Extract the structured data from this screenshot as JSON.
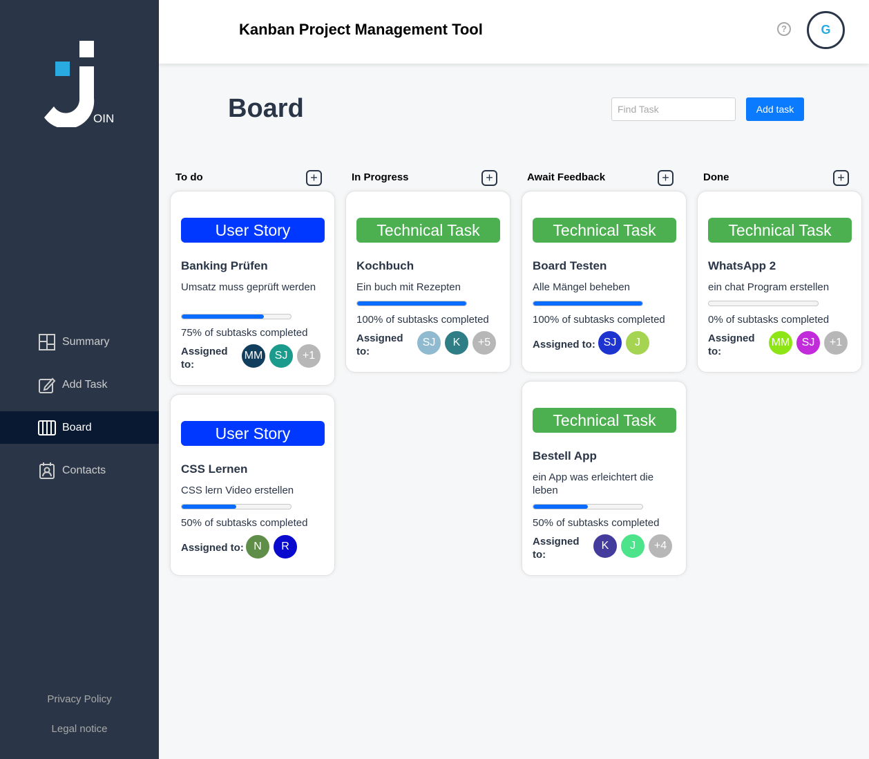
{
  "sidebar": {
    "nav": [
      {
        "label": "Summary",
        "icon": "summary-icon"
      },
      {
        "label": "Add Task",
        "icon": "add-task-icon"
      },
      {
        "label": "Board",
        "icon": "board-icon"
      },
      {
        "label": "Contacts",
        "icon": "contacts-icon"
      }
    ],
    "active": "Board",
    "privacy": "Privacy Policy",
    "legal": "Legal notice",
    "logo_text": "OIN"
  },
  "header": {
    "title": "Kanban Project Management Tool",
    "help": "?",
    "user_initial": "G"
  },
  "board": {
    "title": "Board",
    "search_placeholder": "Find Task",
    "add_task": "Add task"
  },
  "columns": [
    {
      "title": "To do",
      "plus": "+"
    },
    {
      "title": "In Progress",
      "plus": "+"
    },
    {
      "title": "Await Feedback",
      "plus": "+"
    },
    {
      "title": "Done",
      "plus": "+"
    }
  ],
  "cards": [
    {
      "category": "User Story",
      "title": "Banking Prüfen",
      "description": "Umsatz muss geprüft werden",
      "progress": 0.75,
      "progress_text": "75% of subtasks completed",
      "assigned_label": "Assigned to:",
      "avatars": [
        {
          "initials": "MM",
          "color": "#123E5E"
        },
        {
          "initials": "SJ",
          "color": "#1A9B8C"
        },
        {
          "initials": "+1",
          "color": "#B7B7B7"
        }
      ]
    },
    {
      "category": "User Story",
      "title": "CSS Lernen",
      "description": "CSS lern Video erstellen",
      "progress": 0.5,
      "progress_text": "50% of subtasks completed",
      "assigned_label": "Assigned to:",
      "avatars": [
        {
          "initials": "N",
          "color": "#5E8E48"
        },
        {
          "initials": "R",
          "color": "#0A0ACF"
        }
      ]
    },
    {
      "category": "Technical Task",
      "title": "Kochbuch",
      "description": "Ein buch mit Rezepten",
      "progress": 1.0,
      "progress_text": "100% of subtasks completed",
      "assigned_label": "Assigned to:",
      "avatars": [
        {
          "initials": "SJ",
          "color": "#8FBAD0"
        },
        {
          "initials": "K",
          "color": "#2F7E86"
        },
        {
          "initials": "+5",
          "color": "#B7B7B7"
        }
      ]
    },
    {
      "category": "Technical Task",
      "title": "Board Testen",
      "description": "Alle Mängel beheben",
      "progress": 1.0,
      "progress_text": "100% of subtasks completed",
      "assigned_label": "Assigned to:",
      "avatars": [
        {
          "initials": "SJ",
          "color": "#1E34D1"
        },
        {
          "initials": "J",
          "color": "#A5D453"
        }
      ]
    },
    {
      "category": "Technical Task",
      "title": "Bestell App",
      "description": "ein App was erleichtert die leben",
      "progress": 0.5,
      "progress_text": "50% of subtasks completed",
      "assigned_label": "Assigned to:",
      "avatars": [
        {
          "initials": "K",
          "color": "#433C9C"
        },
        {
          "initials": "J",
          "color": "#4CE38A"
        },
        {
          "initials": "+4",
          "color": "#B7B7B7"
        }
      ]
    },
    {
      "category": "Technical Task",
      "title": "WhatsApp 2",
      "description": "ein chat Program erstellen",
      "progress": 0.0,
      "progress_text": "0% of subtasks completed",
      "assigned_label": "Assigned to:",
      "avatars": [
        {
          "initials": "MM",
          "color": "#8EE516"
        },
        {
          "initials": "SJ",
          "color": "#C22BD9"
        },
        {
          "initials": "+1",
          "color": "#B7B7B7"
        }
      ]
    }
  ],
  "colors": {
    "sidebar": "#2A3647",
    "active_nav": "#091931",
    "accent": "#0A7BFF",
    "user_story": "#0038FF",
    "technical_task": "#4CAF50"
  }
}
